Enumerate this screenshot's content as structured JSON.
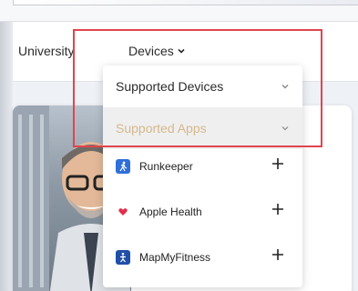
{
  "nav": {
    "university_label": "University",
    "devices_label": "Devices"
  },
  "dropdown": {
    "supported_devices_label": "Supported Devices",
    "supported_apps_label": "Supported Apps",
    "apps": [
      {
        "name": "Runkeeper",
        "icon": "runkeeper-icon"
      },
      {
        "name": "Apple Health",
        "icon": "heart-icon"
      },
      {
        "name": "MapMyFitness",
        "icon": "mapmyfitness-icon"
      }
    ]
  },
  "colors": {
    "highlight": "#e0454d",
    "apps_label": "#d6b88c",
    "apps_row_bg": "#efefef",
    "runkeeper": "#2e6fd9",
    "apple_health": "#e0304a",
    "mapmyfitness": "#1f4fa8"
  }
}
